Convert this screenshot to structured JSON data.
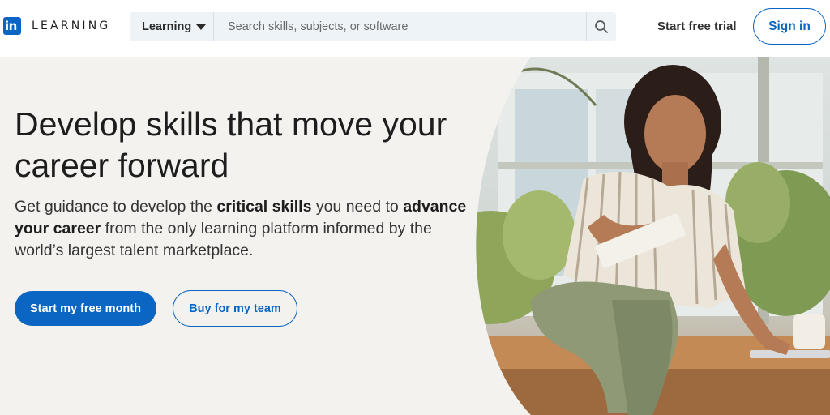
{
  "brand": {
    "logo_letters": "in",
    "product_name": "LEARNING",
    "color": "#0a66c2"
  },
  "search": {
    "category_label": "Learning",
    "placeholder": "Search skills, subjects, or software",
    "value": "",
    "icon": "search-icon"
  },
  "header": {
    "trial_label": "Start free trial",
    "signin_label": "Sign in"
  },
  "hero": {
    "title": "Develop skills that move your career forward",
    "sub_1": "Get guidance to develop the ",
    "sub_bold_1": "critical skills",
    "sub_2": " you need to ",
    "sub_bold_2": "advance your career",
    "sub_3": " from the only learning platform informed by the world’s largest talent marketplace.",
    "primary_cta": "Start my free month",
    "secondary_cta": "Buy for my team",
    "image": "woman-with-notebook-photo"
  }
}
